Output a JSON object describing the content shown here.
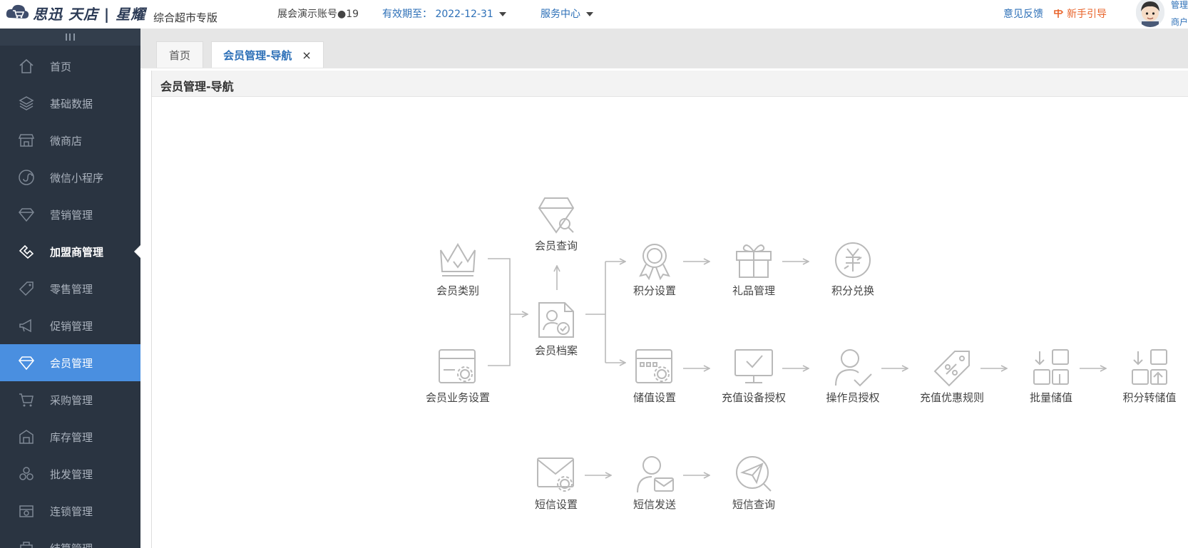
{
  "header": {
    "logo_text": "思迅 天店 | 星耀",
    "edition": "综合超市专版",
    "account": "展会演示账号●19",
    "expiry": "有效期至： 2022-12-31",
    "service": "服务中心",
    "feedback": "意见反馈",
    "guide": "新手引导",
    "user_line1": "管理",
    "user_line2": "商户"
  },
  "sidebar": {
    "items": [
      {
        "label": "首页",
        "icon": "home-icon"
      },
      {
        "label": "基础数据",
        "icon": "layers-icon"
      },
      {
        "label": "微商店",
        "icon": "store-icon"
      },
      {
        "label": "微信小程序",
        "icon": "miniprogram-icon"
      },
      {
        "label": "营销管理",
        "icon": "diamond-icon"
      },
      {
        "label": "加盟商管理",
        "icon": "handshake-icon"
      },
      {
        "label": "零售管理",
        "icon": "tag-icon"
      },
      {
        "label": "促销管理",
        "icon": "megaphone-icon"
      },
      {
        "label": "会员管理",
        "icon": "diamond-icon"
      },
      {
        "label": "采购管理",
        "icon": "cart-icon"
      },
      {
        "label": "库存管理",
        "icon": "warehouse-icon"
      },
      {
        "label": "批发管理",
        "icon": "boxes-icon"
      },
      {
        "label": "连锁管理",
        "icon": "chain-store-icon"
      },
      {
        "label": "结算管理",
        "icon": "settlement-icon"
      }
    ]
  },
  "tabs": [
    {
      "label": "首页"
    },
    {
      "label": "会员管理-导航",
      "close": "×"
    }
  ],
  "content": {
    "title": "会员管理-导航"
  },
  "diagram": {
    "member_category": "会员类别",
    "member_business_settings": "会员业务设置",
    "member_query": "会员查询",
    "member_archive": "会员档案",
    "points_settings": "积分设置",
    "gift_management": "礼品管理",
    "points_exchange": "积分兑换",
    "stored_value_settings": "储值设置",
    "recharge_device_auth": "充值设备授权",
    "operator_auth": "操作员授权",
    "recharge_discount_rules": "充值优惠规则",
    "batch_stored_value": "批量储值",
    "points_to_stored_value": "积分转储值",
    "sms_settings": "短信设置",
    "sms_send": "短信发送",
    "sms_query": "短信查询"
  },
  "colors": {
    "sidebar_bg": "#2a3441",
    "active_item": "#4a8fe0",
    "link_blue": "#2c6fb7",
    "guide_orange": "#e8632a",
    "icon_gray": "#b9b9b9"
  }
}
